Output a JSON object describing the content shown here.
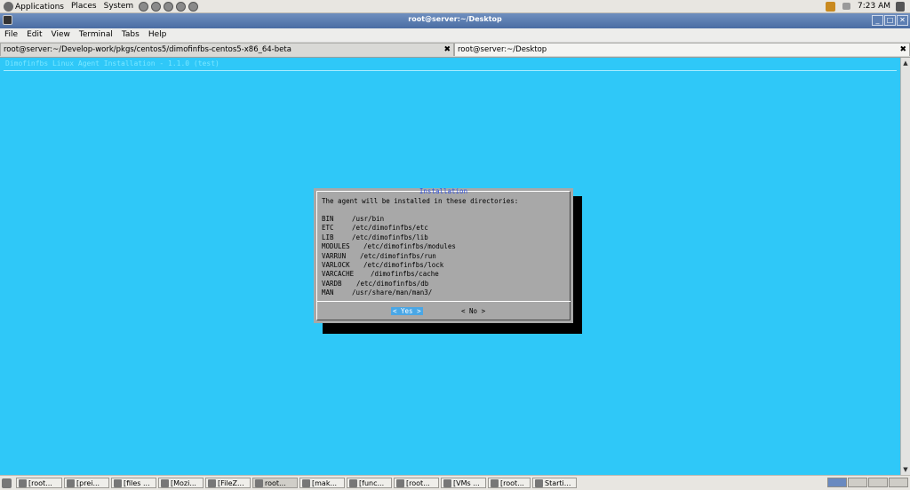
{
  "top_panel": {
    "menus": [
      "Applications",
      "Places",
      "System"
    ],
    "launcher_icons": [
      "browser-icon",
      "mail-icon",
      "edit-icon",
      "screenshot-icon",
      "network-icon"
    ],
    "clock": "7:23 AM"
  },
  "window": {
    "title": "root@server:~/Desktop",
    "menubar": [
      "File",
      "Edit",
      "View",
      "Terminal",
      "Tabs",
      "Help"
    ],
    "tabs": [
      {
        "label": "root@server:~/Develop-work/pkgs/centos5/dimofinfbs-centos5-x86_64-beta",
        "active": false
      },
      {
        "label": "root@server:~/Desktop",
        "active": true
      }
    ],
    "close_glyph": "✖"
  },
  "terminal": {
    "header": "Dimofinfbs Linux Agent Installation - 1.1.0 (test)",
    "background": "#2fc8f8"
  },
  "dialog": {
    "title": "Installation",
    "intro": "The agent will be installed in these directories:",
    "dirs": [
      {
        "name": "BIN",
        "path": "/usr/bin"
      },
      {
        "name": "ETC",
        "path": "/etc/dimofinfbs/etc"
      },
      {
        "name": "LIB",
        "path": "/etc/dimofinfbs/lib"
      },
      {
        "name": "MODULES",
        "path": "/etc/dimofinfbs/modules"
      },
      {
        "name": "VARRUN",
        "path": "/etc/dimofinfbs/run"
      },
      {
        "name": "VARLOCK",
        "path": "/etc/dimofinfbs/lock"
      },
      {
        "name": "VARCACHE",
        "path": "/dimofinfbs/cache"
      },
      {
        "name": "VARDB",
        "path": "/etc/dimofinfbs/db"
      },
      {
        "name": "MAN",
        "path": "/usr/share/man/man3/"
      }
    ],
    "yes_label": "< Yes >",
    "no_label": "< No  >"
  },
  "taskbar": {
    "items": [
      "[root...",
      "[prei...",
      "[files ...",
      "[Mozi...",
      "[FileZ...",
      "root...",
      "[mak...",
      "[func...",
      "[root...",
      "[VMs ...",
      "[root...",
      "Starti..."
    ],
    "active_index": 5
  }
}
